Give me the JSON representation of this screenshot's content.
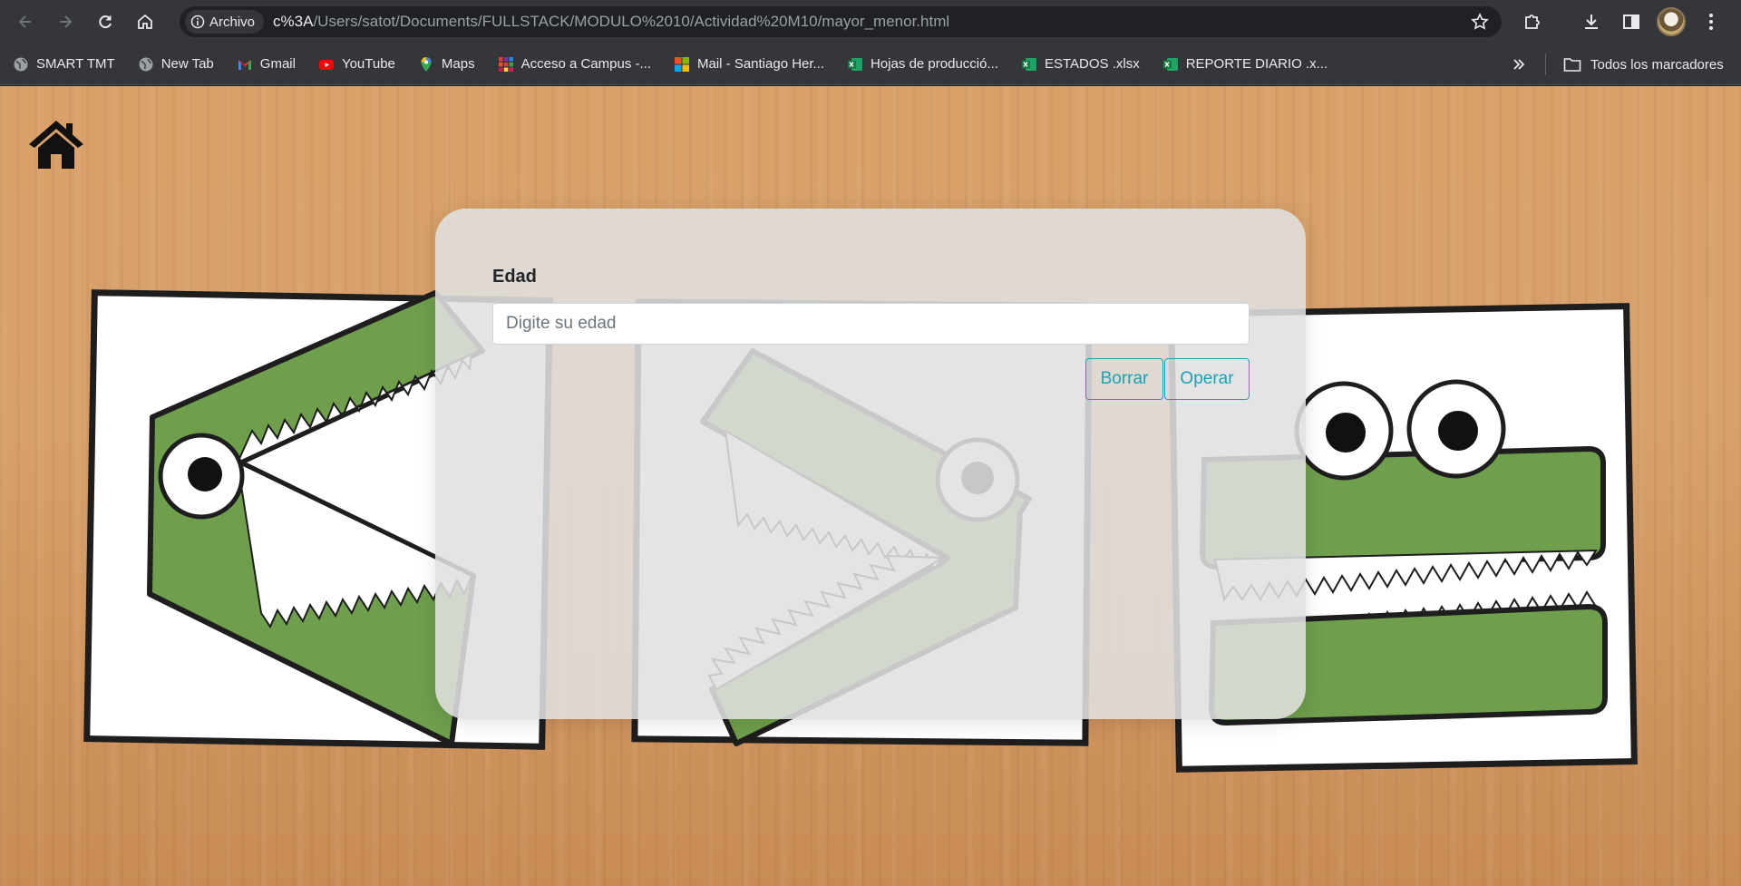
{
  "browser": {
    "site_chip": "Archivo",
    "url_host": "c%3A",
    "url_path": "/Users/satot/Documents/FULLSTACK/MODULO%2010/Actividad%20M10/mayor_menor.html"
  },
  "bookmarks": {
    "items": [
      {
        "label": "SMART TMT",
        "icon": "globe-icon"
      },
      {
        "label": "New Tab",
        "icon": "globe-icon"
      },
      {
        "label": "Gmail",
        "icon": "gmail-icon"
      },
      {
        "label": "YouTube",
        "icon": "youtube-icon"
      },
      {
        "label": "Maps",
        "icon": "maps-icon"
      },
      {
        "label": "Acceso a Campus -...",
        "icon": "grid-icon"
      },
      {
        "label": "Mail - Santiago Her...",
        "icon": "microsoft-icon"
      },
      {
        "label": "Hojas de producció...",
        "icon": "excel-icon"
      },
      {
        "label": "ESTADOS .xlsx",
        "icon": "excel-icon"
      },
      {
        "label": "REPORTE DIARIO .x...",
        "icon": "excel-icon"
      }
    ],
    "all_bookmarks_label": "Todos los marcadores"
  },
  "page": {
    "form": {
      "label": "Edad",
      "input_placeholder": "Digite su edad",
      "input_value": "",
      "clear_button": "Borrar",
      "submit_button": "Operar"
    }
  },
  "colors": {
    "button_accent": "#17a2b8",
    "crocodile_green": "#6f9e4c",
    "wood": "#d9a06a"
  }
}
